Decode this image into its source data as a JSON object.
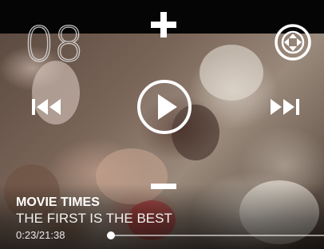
{
  "overlay": {
    "counter": "08",
    "icons": {
      "volume_up": "plus-icon",
      "volume_down": "minus-icon",
      "move": "move-arrows-icon",
      "previous": "skip-previous-icon",
      "next": "skip-next-icon",
      "play": "play-icon"
    }
  },
  "media": {
    "title": "MOVIE TIMES",
    "subtitle": "THE FIRST IS THE BEST",
    "time": "0:23/21:38",
    "progress": 0.018
  },
  "colors": {
    "icon": "#ffffff",
    "top_bar": "#050505"
  }
}
